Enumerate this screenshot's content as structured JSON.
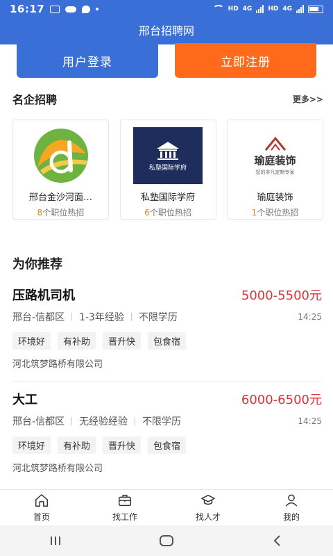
{
  "status": {
    "time": "16:17",
    "net1": "HD",
    "net2": "4G",
    "net3": "HD",
    "net4": "4G"
  },
  "header": {
    "title": "邢台招聘网"
  },
  "auth": {
    "login_label": "用户登录",
    "register_label": "立即注册"
  },
  "companies_section": {
    "title": "名企招聘",
    "more_label": "更多>>",
    "job_suffix": "个职位热招",
    "items": [
      {
        "name": "邢台金沙河面…",
        "count": "8"
      },
      {
        "name": "私塾国际学府",
        "count": "6",
        "logo_text": "私塾国际学府"
      },
      {
        "name": "瑜庭装饰",
        "count": "1",
        "logo_text": "瑜庭装饰",
        "logo_sub": "您的非凡定制专家"
      }
    ]
  },
  "recommend": {
    "title": "为你推荐",
    "jobs": [
      {
        "title": "压路机司机",
        "salary": "5000-5500元",
        "location": "邢台-信都区",
        "experience": "1-3年经验",
        "education": "不限学历",
        "time": "14:25",
        "tags": [
          "环境好",
          "有补助",
          "晋升快",
          "包食宿"
        ],
        "company": "河北筑梦路桥有限公司"
      },
      {
        "title": "大工",
        "salary": "6000-6500元",
        "location": "邢台-信都区",
        "experience": "无经验经验",
        "education": "不限学历",
        "time": "14:25",
        "tags": [
          "环境好",
          "有补助",
          "晋升快",
          "包食宿"
        ],
        "company": "河北筑梦路桥有限公司"
      }
    ]
  },
  "tabbar": {
    "items": [
      "首页",
      "找工作",
      "找人才",
      "我的"
    ]
  },
  "colors": {
    "primary": "#3a6fd8",
    "accent": "#ff6a1a",
    "salary": "#d8343a",
    "count": "#e08a1e"
  }
}
